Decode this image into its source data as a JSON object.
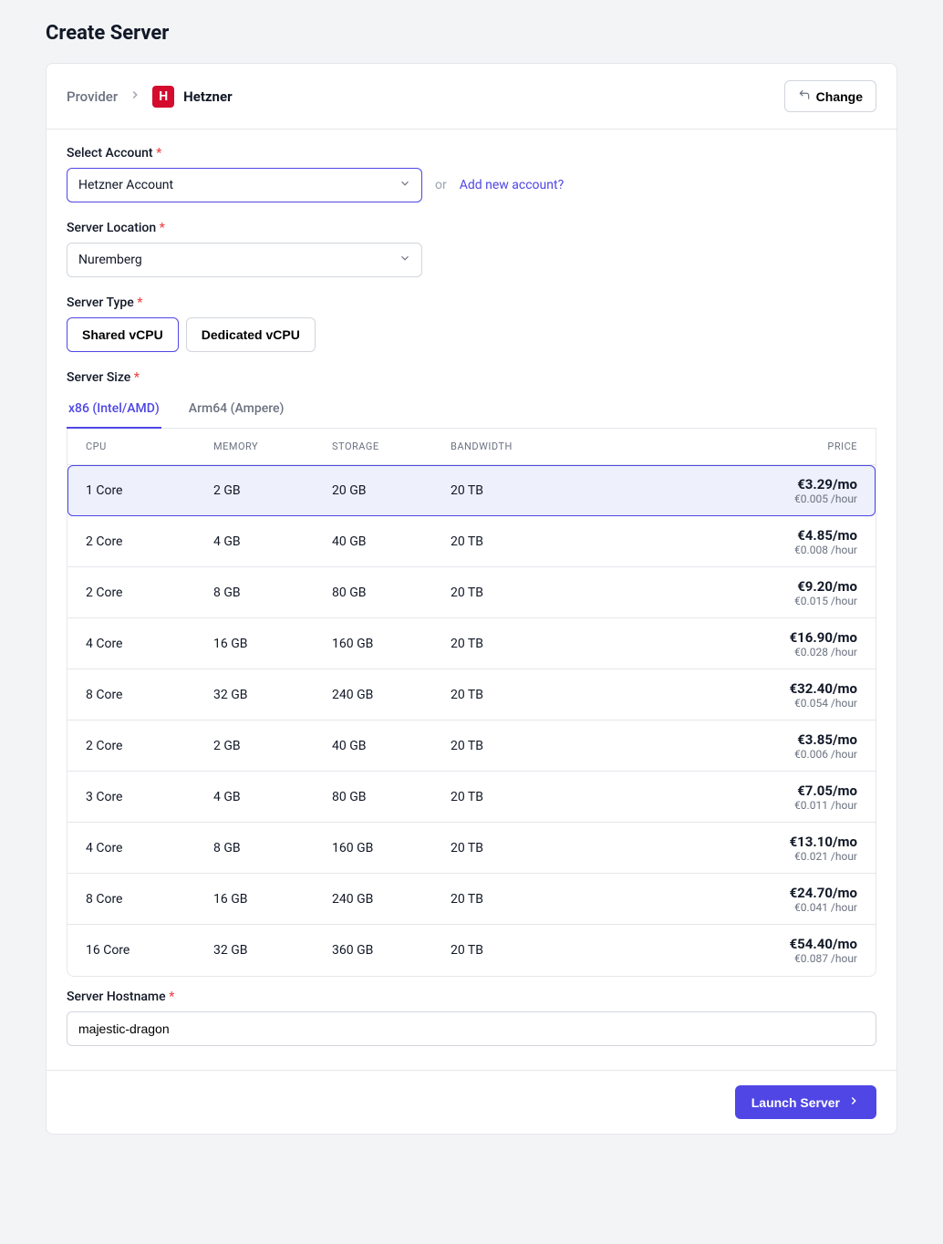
{
  "page_title": "Create Server",
  "breadcrumb": {
    "provider_label": "Provider",
    "provider_name": "Hetzner"
  },
  "change_button": "Change",
  "account": {
    "label": "Select Account",
    "selected": "Hetzner Account",
    "or": "or",
    "add_link": "Add new account?"
  },
  "location": {
    "label": "Server Location",
    "selected": "Nuremberg"
  },
  "server_type": {
    "label": "Server Type",
    "options": [
      "Shared vCPU",
      "Dedicated vCPU"
    ],
    "active_index": 0
  },
  "server_size": {
    "label": "Server Size",
    "arch_tabs": [
      "x86 (Intel/AMD)",
      "Arm64 (Ampere)"
    ],
    "active_arch_index": 0,
    "columns": [
      "CPU",
      "MEMORY",
      "STORAGE",
      "BANDWIDTH",
      "PRICE"
    ],
    "selected_index": 0,
    "rows": [
      {
        "cpu": "1 Core",
        "memory": "2 GB",
        "storage": "20 GB",
        "bandwidth": "20 TB",
        "price_mo": "€3.29/mo",
        "price_hr": "€0.005 /hour"
      },
      {
        "cpu": "2 Core",
        "memory": "4 GB",
        "storage": "40 GB",
        "bandwidth": "20 TB",
        "price_mo": "€4.85/mo",
        "price_hr": "€0.008 /hour"
      },
      {
        "cpu": "2 Core",
        "memory": "8 GB",
        "storage": "80 GB",
        "bandwidth": "20 TB",
        "price_mo": "€9.20/mo",
        "price_hr": "€0.015 /hour"
      },
      {
        "cpu": "4 Core",
        "memory": "16 GB",
        "storage": "160 GB",
        "bandwidth": "20 TB",
        "price_mo": "€16.90/mo",
        "price_hr": "€0.028 /hour"
      },
      {
        "cpu": "8 Core",
        "memory": "32 GB",
        "storage": "240 GB",
        "bandwidth": "20 TB",
        "price_mo": "€32.40/mo",
        "price_hr": "€0.054 /hour"
      },
      {
        "cpu": "2 Core",
        "memory": "2 GB",
        "storage": "40 GB",
        "bandwidth": "20 TB",
        "price_mo": "€3.85/mo",
        "price_hr": "€0.006 /hour"
      },
      {
        "cpu": "3 Core",
        "memory": "4 GB",
        "storage": "80 GB",
        "bandwidth": "20 TB",
        "price_mo": "€7.05/mo",
        "price_hr": "€0.011 /hour"
      },
      {
        "cpu": "4 Core",
        "memory": "8 GB",
        "storage": "160 GB",
        "bandwidth": "20 TB",
        "price_mo": "€13.10/mo",
        "price_hr": "€0.021 /hour"
      },
      {
        "cpu": "8 Core",
        "memory": "16 GB",
        "storage": "240 GB",
        "bandwidth": "20 TB",
        "price_mo": "€24.70/mo",
        "price_hr": "€0.041 /hour"
      },
      {
        "cpu": "16 Core",
        "memory": "32 GB",
        "storage": "360 GB",
        "bandwidth": "20 TB",
        "price_mo": "€54.40/mo",
        "price_hr": "€0.087 /hour"
      }
    ]
  },
  "hostname": {
    "label": "Server Hostname",
    "value": "majestic-dragon"
  },
  "launch_button": "Launch Server"
}
